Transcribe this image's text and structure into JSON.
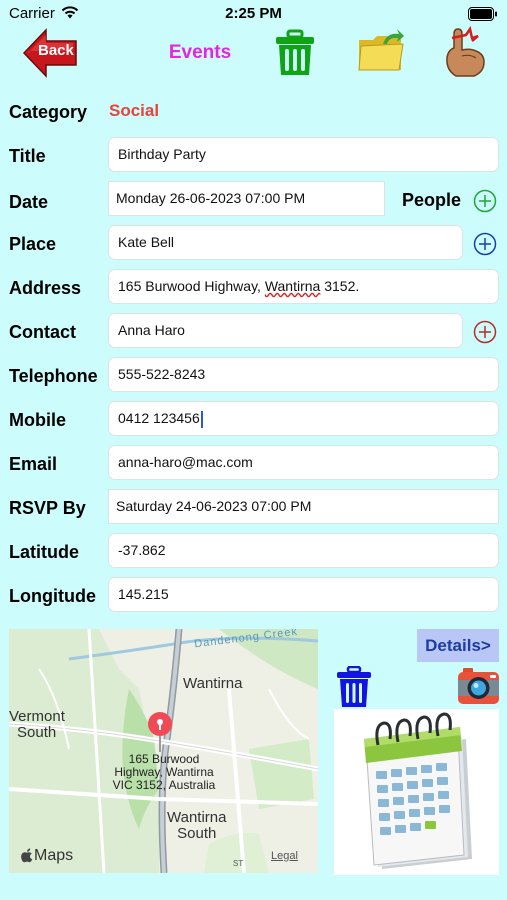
{
  "status_bar": {
    "carrier": "Carrier",
    "time": "2:25 PM"
  },
  "toolbar": {
    "title": "Events",
    "back_label": "Back"
  },
  "form": {
    "category": {
      "label": "Category",
      "value": "Social"
    },
    "title": {
      "label": "Title",
      "value": "Birthday Party"
    },
    "date": {
      "label": "Date",
      "value": "Monday 26-06-2023 07:00 PM"
    },
    "people_label": "People",
    "place": {
      "label": "Place",
      "value": "Kate Bell"
    },
    "address": {
      "label": "Address",
      "value_prefix": "165 Burwood Highway, ",
      "value_misspelled": "Wantirna",
      "value_suffix": " 3152."
    },
    "contact": {
      "label": "Contact",
      "value": "Anna Haro"
    },
    "telephone": {
      "label": "Telephone",
      "value": "555-522-8243"
    },
    "mobile": {
      "label": "Mobile",
      "value": "0412 123456"
    },
    "email": {
      "label": "Email",
      "value": "anna-haro@mac.com"
    },
    "rsvp": {
      "label": "RSVP By",
      "value": "Saturday 24-06-2023 07:00 PM"
    },
    "latitude": {
      "label": "Latitude",
      "value": "-37.862"
    },
    "longitude": {
      "label": "Longitude",
      "value": "145.215"
    }
  },
  "map": {
    "creek": "Dandenong Creek",
    "suburb_1": "Wantirna",
    "suburb_2_line1": "Vermont",
    "suburb_2_line2": "South",
    "suburb_3_line1": "Wantirna",
    "suburb_3_line2": "South",
    "pin_line1": "165 Burwood",
    "pin_line2": "Highway, Wantirna",
    "pin_line3": "VIC 3152, Australia",
    "brand": "Maps",
    "legal": "Legal",
    "street": "ST"
  },
  "details_button": "Details>",
  "colors": {
    "background": "#ccfcfb",
    "title": "#e524e5",
    "category": "#e8443a",
    "trash": "#0fa414",
    "details_bg": "#b9c7f7"
  },
  "icons": [
    "back-arrow-icon",
    "trash-icon",
    "folder-icon",
    "hand-reminder-icon",
    "plus-circle-icon",
    "camera-icon",
    "calendar-icon",
    "map-pin-icon",
    "apple-logo-icon"
  ]
}
